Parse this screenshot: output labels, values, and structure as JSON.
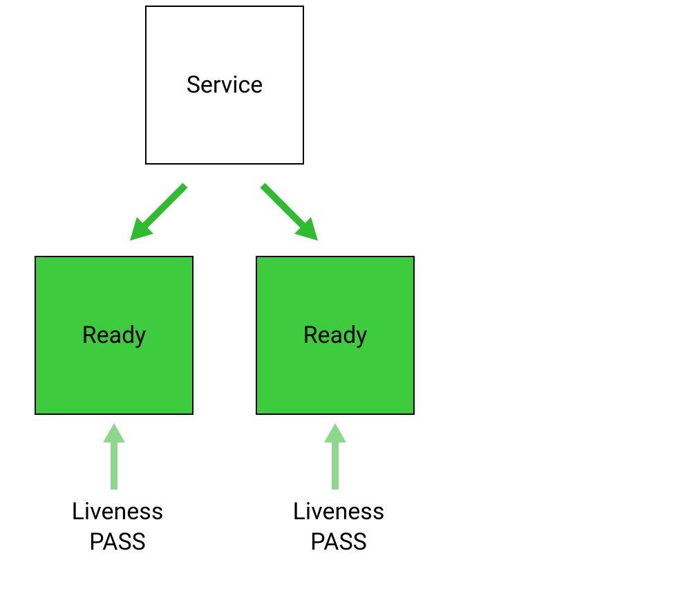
{
  "service": {
    "label": "Service"
  },
  "pods": [
    {
      "state": "Ready"
    },
    {
      "state": "Ready"
    }
  ],
  "liveness": [
    {
      "line1": "Liveness",
      "line2": "PASS"
    },
    {
      "line1": "Liveness",
      "line2": "PASS"
    }
  ],
  "colors": {
    "ready_bg": "#3ecc3e",
    "arrow_dark": "#2fbc2f",
    "arrow_light": "#8cd98c"
  }
}
